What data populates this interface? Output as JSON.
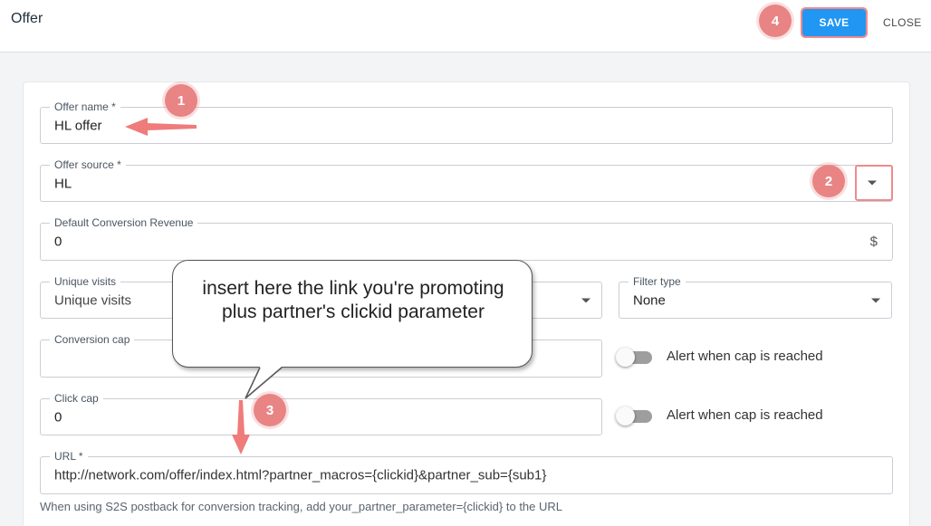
{
  "header": {
    "title": "Offer",
    "save_label": "SAVE",
    "close_label": "CLOSE"
  },
  "form": {
    "offer_name": {
      "label": "Offer name *",
      "value": "HL offer"
    },
    "offer_source": {
      "label": "Offer source *",
      "value": "HL"
    },
    "default_revenue": {
      "label": "Default Conversion Revenue",
      "value": "0",
      "suffix": "$"
    },
    "unique_visits": {
      "label": "Unique visits",
      "value": "Unique visits"
    },
    "filter_type": {
      "label": "Filter type",
      "value": "None"
    },
    "conversion_cap": {
      "label": "Conversion cap",
      "value": "",
      "alert_label": "Alert when cap is reached",
      "alert_on": false
    },
    "click_cap": {
      "label": "Click cap",
      "value": "0",
      "alert_label": "Alert when cap is reached",
      "alert_on": false
    },
    "url": {
      "label": "URL *",
      "value": "http://network.com/offer/index.html?partner_macros={clickid}&partner_sub={sub1}"
    },
    "hint": "When using S2S postback for conversion tracking, add your_partner_parameter={clickid} to the URL"
  },
  "annotations": {
    "badges": [
      "1",
      "2",
      "3",
      "4"
    ],
    "callout": "insert here the link you're promoting plus partner's clickid parameter",
    "color": "#e98484"
  },
  "colors": {
    "primary": "#2196f3",
    "highlight": "#f08a8a"
  }
}
